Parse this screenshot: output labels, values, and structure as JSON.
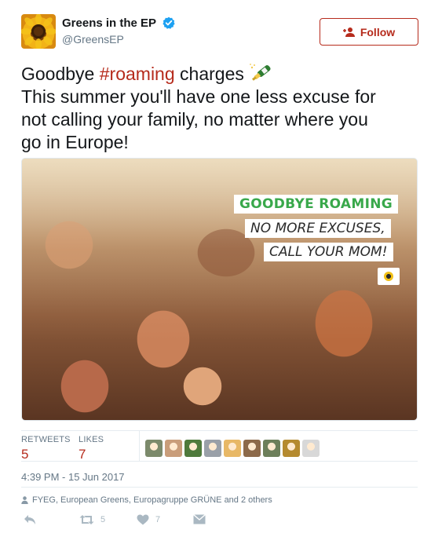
{
  "user": {
    "display_name": "Greens in the EP",
    "handle": "@GreensEP",
    "verified_icon": "verified-badge-icon"
  },
  "follow_button": {
    "label": "Follow",
    "icon": "add-user-icon"
  },
  "tweet": {
    "line1_prefix": "Goodbye ",
    "hashtag": "#roaming",
    "line1_suffix": " charges ",
    "emoji": "champagne-bottle-icon",
    "line2": "This summer you'll have one less excuse for",
    "line3": "not calling your family, no matter where you",
    "line4": "go in Europe!"
  },
  "media": {
    "banner_1": "GOODBYE ROAMING",
    "banner_2": "NO MORE EXCUSES,",
    "banner_3": "CALL YOUR MOM!"
  },
  "stats": {
    "retweets_label": "RETWEETS",
    "retweets_value": "5",
    "likes_label": "LIKES",
    "likes_value": "7",
    "liker_avatar_colors": [
      "#7c8a6b",
      "#c99d7a",
      "#4f7a3c",
      "#9aa0a8",
      "#e8b866",
      "#8d6a4a",
      "#6d7f5a",
      "#b58a2f",
      "#d8d8d8"
    ]
  },
  "timestamp": "4:39 PM - 15 Jun 2017",
  "context": {
    "icon": "person-icon",
    "text": "FYEG, European Greens, Europagruppe GRÜNE and 2 others"
  },
  "actions": {
    "reply_icon": "reply-icon",
    "retweet_icon": "retweet-icon",
    "retweet_count": "5",
    "like_icon": "heart-icon",
    "like_count": "7",
    "dm_icon": "envelope-icon"
  },
  "colors": {
    "accent": "#b62b1c",
    "verified_blue": "#1da1f2",
    "banner_green": "#39a84b",
    "muted": "#657786"
  }
}
